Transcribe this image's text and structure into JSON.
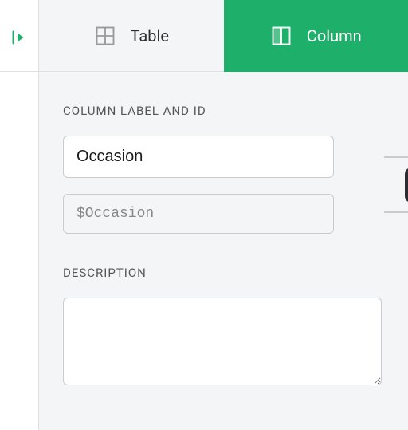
{
  "tabs": {
    "table": "Table",
    "column": "Column"
  },
  "sections": {
    "label_id": "COLUMN LABEL AND ID",
    "description": "DESCRIPTION"
  },
  "fields": {
    "label_value": "Occasion",
    "id_value": "$Occasion",
    "description_value": ""
  },
  "colors": {
    "accent": "#1eaf6a"
  }
}
